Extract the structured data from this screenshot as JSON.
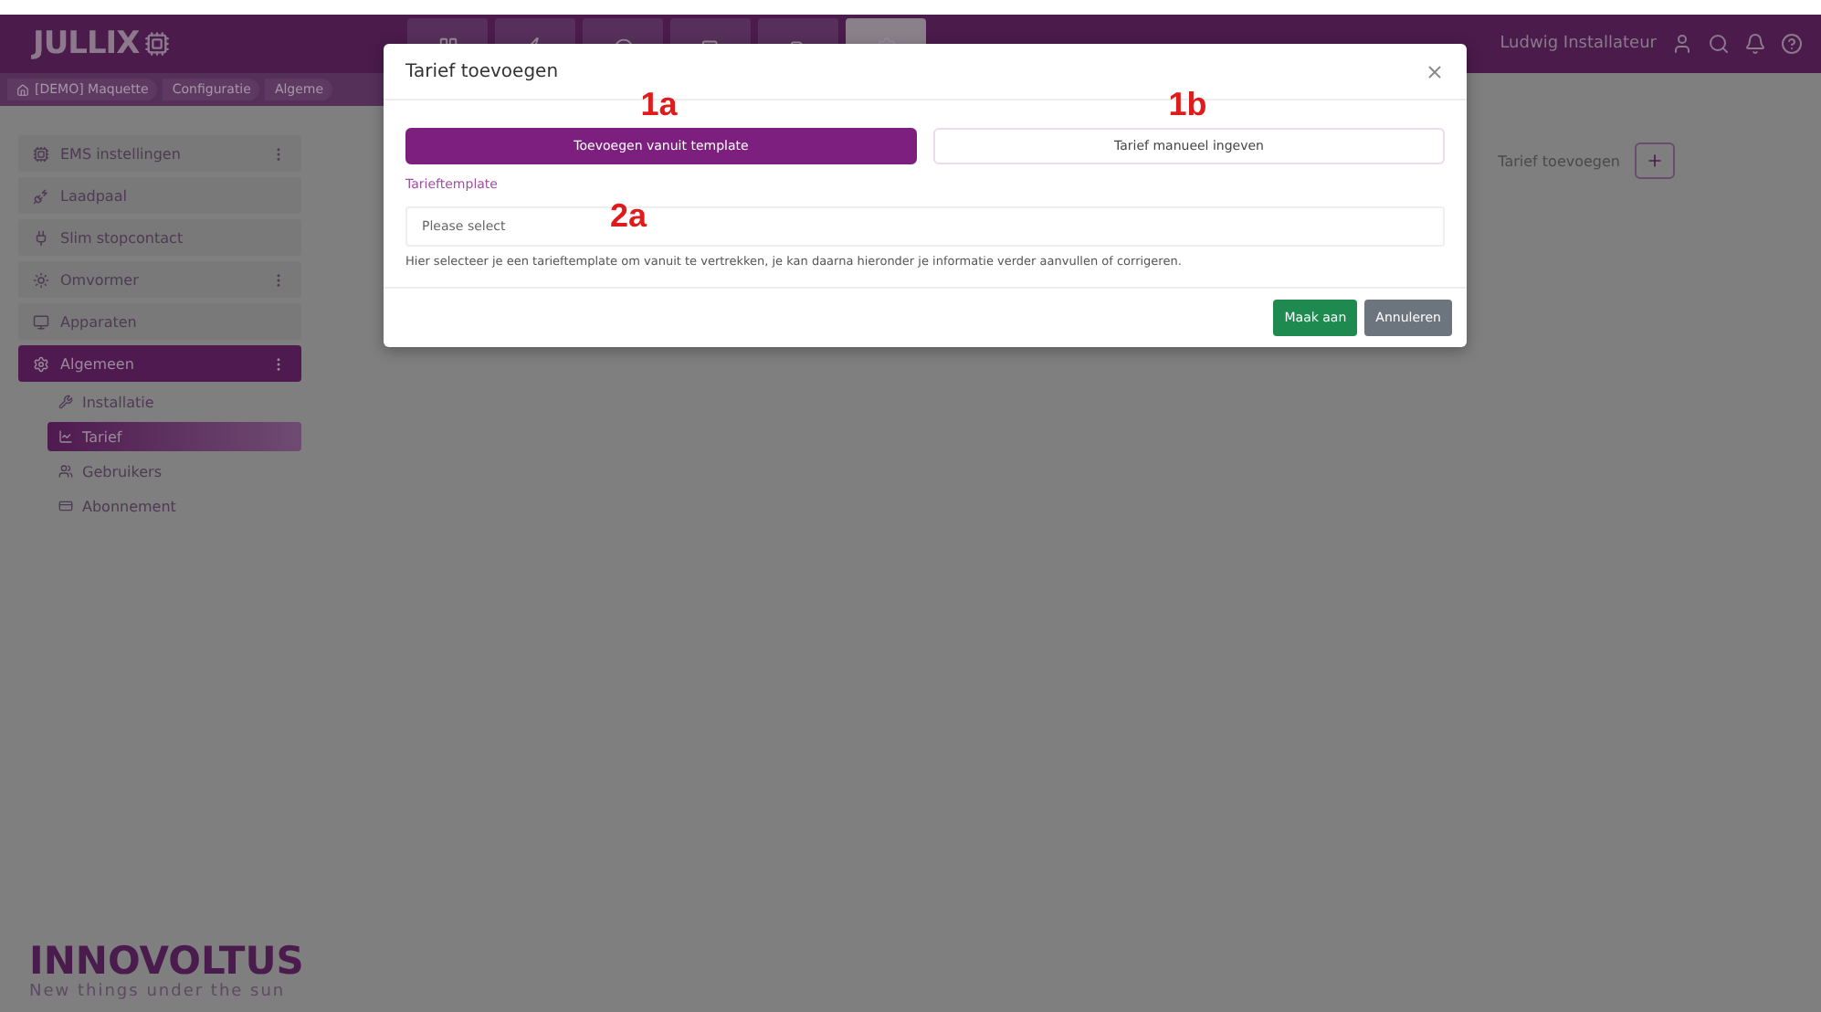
{
  "header": {
    "logo": "JULLIX",
    "user": "Ludwig Installateur",
    "nav_tabs": [
      {
        "selected": false
      },
      {
        "selected": false
      },
      {
        "selected": false
      },
      {
        "selected": false
      },
      {
        "selected": false
      },
      {
        "selected": true
      }
    ]
  },
  "breadcrumb": [
    "[DEMO] Maquette",
    "Configuratie",
    "Algeme"
  ],
  "sidebar": {
    "items": [
      {
        "label": "EMS instellingen",
        "menu": true,
        "selected": false
      },
      {
        "label": "Laadpaal",
        "menu": false,
        "selected": false
      },
      {
        "label": "Slim stopcontact",
        "menu": false,
        "selected": false
      },
      {
        "label": "Omvormer",
        "menu": true,
        "selected": false
      },
      {
        "label": "Apparaten",
        "menu": false,
        "selected": false
      },
      {
        "label": "Algemeen",
        "menu": true,
        "selected": true,
        "children": [
          {
            "label": "Installatie",
            "selected": false
          },
          {
            "label": "Tarief",
            "selected": true
          },
          {
            "label": "Gebruikers",
            "selected": false
          },
          {
            "label": "Abonnement",
            "selected": false
          }
        ]
      }
    ]
  },
  "content": {
    "add_label": "Tarief toevoegen"
  },
  "footer": {
    "brand": "INNOVOLTUS",
    "tagline": "New things under the sun"
  },
  "modal": {
    "title": "Tarief toevoegen",
    "modes": [
      {
        "label": "Toevoegen vanuit template",
        "selected": true,
        "annotation": "1a"
      },
      {
        "label": "Tarief manueel ingeven",
        "selected": false,
        "annotation": "1b"
      }
    ],
    "field_label": "Tarieftemplate",
    "placeholder": "Please select",
    "field_annotation": "2a",
    "help": "Hier selecteer je een tarieftemplate om vanuit te vertrekken, je kan daarna hieronder je informatie verder aanvullen of corrigeren.",
    "buttons": [
      {
        "label": "Maak aan",
        "kind": "primary"
      },
      {
        "label": "Annuleren",
        "kind": "secondary"
      }
    ]
  }
}
